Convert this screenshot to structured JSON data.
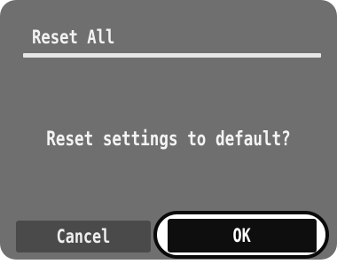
{
  "dialog": {
    "title": "Reset All",
    "message": "Reset settings to default?",
    "buttons": {
      "cancel_label": "Cancel",
      "ok_label": "OK"
    },
    "selected_button": "OK"
  },
  "colors": {
    "dialog_background": "#6f6f6f",
    "cancel_button_background": "#4a4a4a",
    "ok_button_background": "#0e0e0e",
    "selection_ring": "#0a0a0a",
    "text": "#f2f2f2"
  }
}
